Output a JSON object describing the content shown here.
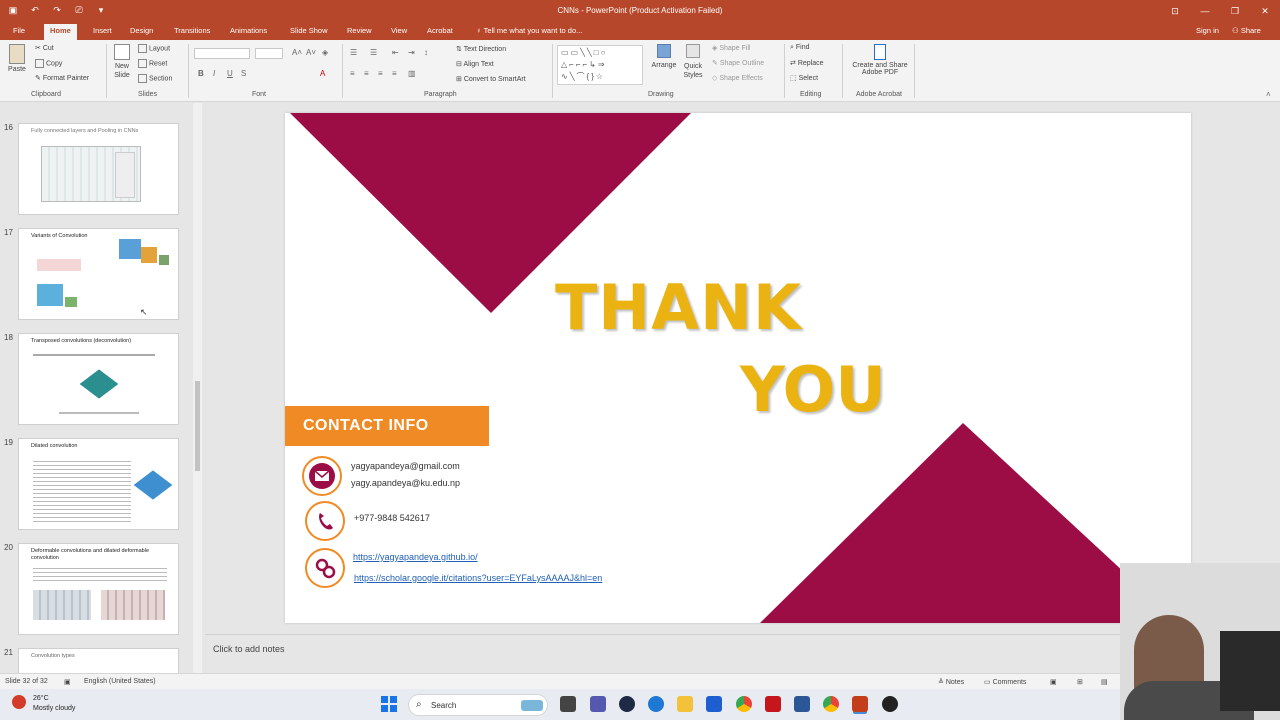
{
  "window": {
    "title": "CNNs - PowerPoint (Product Activation Failed)",
    "controls": [
      "⊡",
      "—",
      "❐",
      "✕"
    ]
  },
  "tabs": [
    "File",
    "Home",
    "Insert",
    "Design",
    "Transitions",
    "Animations",
    "Slide Show",
    "Review",
    "View",
    "Acrobat"
  ],
  "tell_me": "Tell me what you want to do...",
  "sign_in": "Sign in",
  "share": "Share",
  "ribbon": {
    "clipboard": {
      "paste": "Paste",
      "cut": "Cut",
      "copy": "Copy",
      "format_painter": "Format Painter",
      "label": "Clipboard"
    },
    "slides": {
      "new_slide": "New Slide",
      "layout": "Layout",
      "reset": "Reset",
      "section": "Section",
      "label": "Slides"
    },
    "font": {
      "label": "Font",
      "bold": "B",
      "italic": "I",
      "underline": "U",
      "strike": "S"
    },
    "paragraph": {
      "text_direction": "Text Direction",
      "align_text": "Align Text",
      "convert_smartart": "Convert to SmartArt",
      "label": "Paragraph"
    },
    "drawing": {
      "arrange": "Arrange",
      "quick_styles": "Quick Styles",
      "shape_fill": "Shape Fill",
      "shape_outline": "Shape Outline",
      "shape_effects": "Shape Effects",
      "label": "Drawing"
    },
    "editing": {
      "find": "Find",
      "replace": "Replace",
      "select": "Select",
      "label": "Editing"
    },
    "acrobat": {
      "create_share": "Create and Share",
      "adobe_pdf": "Adobe PDF",
      "label": "Adobe Acrobat"
    }
  },
  "thumbnails": [
    {
      "num": "16",
      "title": "Fully connected layers and Pooling in CNNs"
    },
    {
      "num": "17",
      "title": "Variants of Convolution"
    },
    {
      "num": "18",
      "title": "Transposed convolutions (deconvolution)"
    },
    {
      "num": "19",
      "title": "Dilated convolution"
    },
    {
      "num": "20",
      "title": "Deformable convolutions and dilated deformable convolution"
    },
    {
      "num": "21",
      "title": "Convolution types"
    }
  ],
  "slide": {
    "thank": "THANK",
    "you": "YOU",
    "contact_header": "CONTACT INFO",
    "email1": "yagyapandeya@gmail.com",
    "email2": "yagy.apandeya@ku.edu.np",
    "phone": "+977-9848 542617",
    "link1": "https://yagyapandeya.github.io/",
    "link2": "https://scholar.google.it/citations?user=EYFaLysAAAAJ&hl=en",
    "colors": {
      "crimson": "#9d0d45",
      "gold": "#eab312",
      "orange": "#f08a24"
    }
  },
  "notes_placeholder": "Click to add notes",
  "status": {
    "slide": "Slide 32 of 32",
    "language": "English (United States)",
    "notes": "Notes",
    "comments": "Comments"
  },
  "taskbar": {
    "temp": "26°C",
    "weather": "Mostly cloudy",
    "search": "Search"
  }
}
